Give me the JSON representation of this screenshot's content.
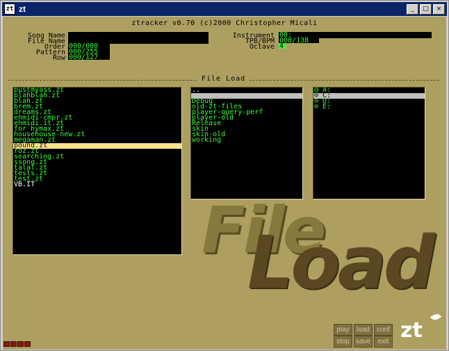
{
  "window": {
    "icon_text": "zt",
    "title": "zt"
  },
  "header": "ztracker v0.70 (c)2000 Christopher Micali",
  "song": {
    "song_name_label": "Song Name",
    "file_name_label": "File Name",
    "order_label": "Order",
    "order_value": "000/000",
    "pattern_label": "Pattern",
    "pattern_value": "000/255",
    "row_label": "Row",
    "row_value": "000/127"
  },
  "instrument": {
    "instrument_label": "Instrument",
    "instrument_value": "00:",
    "tpb_label": "TPB/BPM",
    "tpb_value": "008/138",
    "octave_label": "Octave",
    "octave_value": "4"
  },
  "section_title": "File Load",
  "files": [
    "bustmyass.zt",
    "blahblah.zt",
    "blah.zt",
    "brem.zt",
    "dreams.zt",
    "ehmidi-cmpr.zt",
    "ehmidi.it.zt",
    "for hymax.zt",
    "househouse-new.zt",
    "megaman.zt",
    "pound.zt",
    "roz.zt",
    "searching.zt",
    "ssong.zt",
    "talal.zt",
    "tests.zt",
    "test.zt",
    "VB.IT"
  ],
  "dirs": [
    "..",
    "",
    "Debug",
    "old-zt-files",
    "player-query-perf",
    "player-old",
    "Release",
    "skin",
    "skin-old",
    "working"
  ],
  "drives": [
    "@ A:",
    "⊖ C:",
    "⊖ D:",
    "⊖ E:"
  ],
  "big_text": {
    "line1": "File",
    "line2": "Load"
  },
  "buttons": {
    "play": "play",
    "load": "load",
    "conf": "conf",
    "stop": "stop",
    "save": "save",
    "exit": "exit"
  },
  "logo": "zt"
}
